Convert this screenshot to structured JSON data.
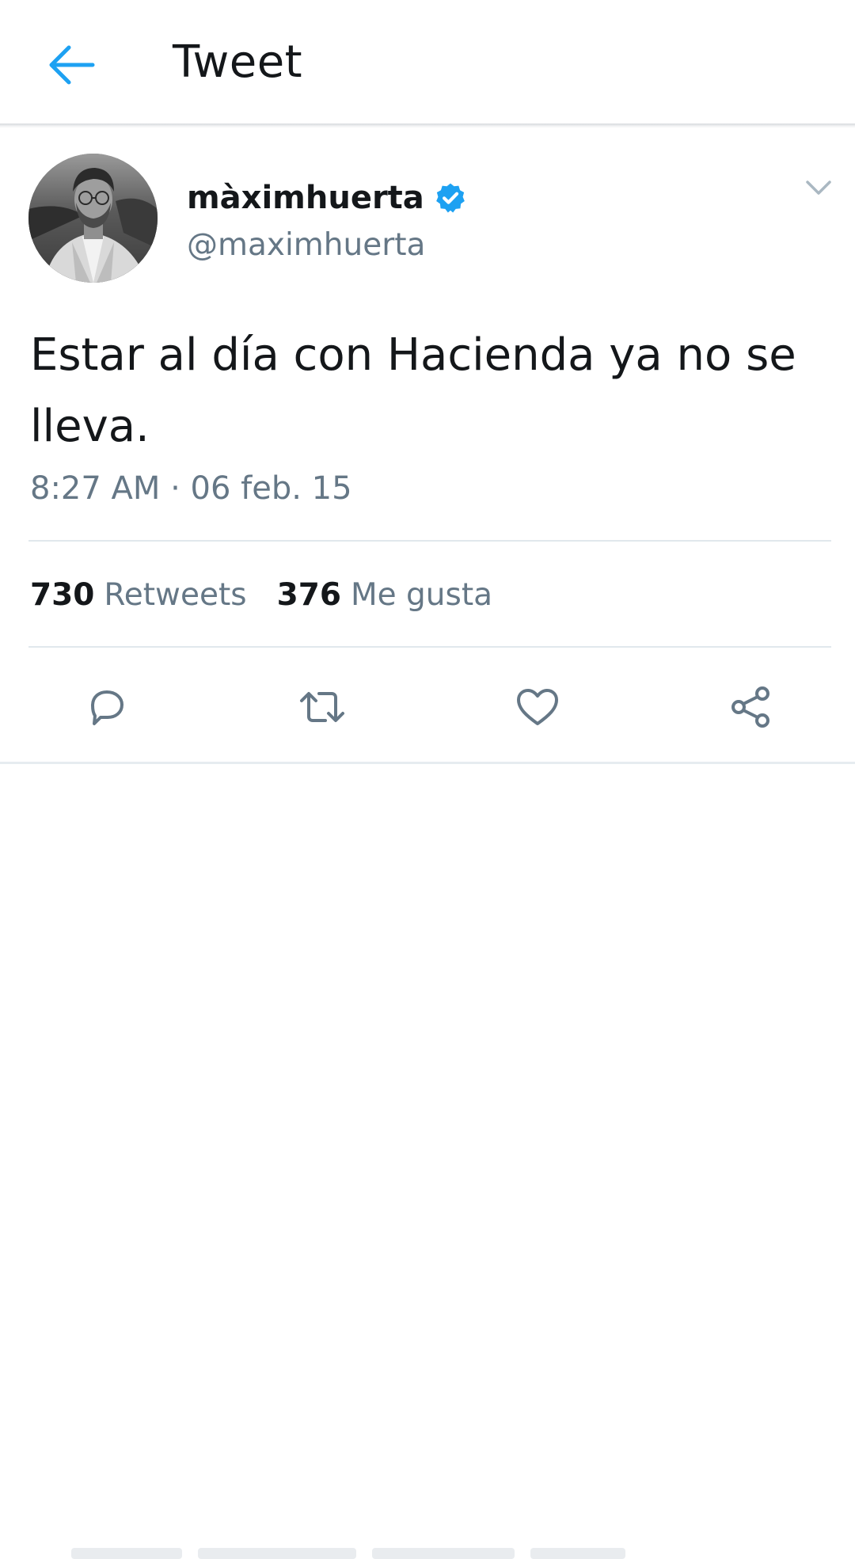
{
  "header": {
    "title": "Tweet",
    "back_icon": "arrow-left-icon",
    "accent_color": "#1da1f2"
  },
  "author": {
    "display_name": "màximhuerta",
    "handle": "@maximhuerta",
    "verified": true,
    "verified_icon": "verified-badge-icon"
  },
  "tweet": {
    "text": "Estar al día con Hacienda ya no se lleva.",
    "timestamp": "8:27 AM · 06 feb. 15"
  },
  "stats": {
    "retweets_count": "730",
    "retweets_label": "Retweets",
    "likes_count": "376",
    "likes_label": "Me gusta"
  },
  "actions": [
    {
      "name": "reply",
      "icon": "reply-icon"
    },
    {
      "name": "retweet",
      "icon": "retweet-icon"
    },
    {
      "name": "like",
      "icon": "heart-icon"
    },
    {
      "name": "share",
      "icon": "share-icon"
    }
  ],
  "colors": {
    "text_primary": "#14171a",
    "text_secondary": "#657786",
    "icon_gray": "#657786",
    "divider": "#e1e8ed"
  }
}
